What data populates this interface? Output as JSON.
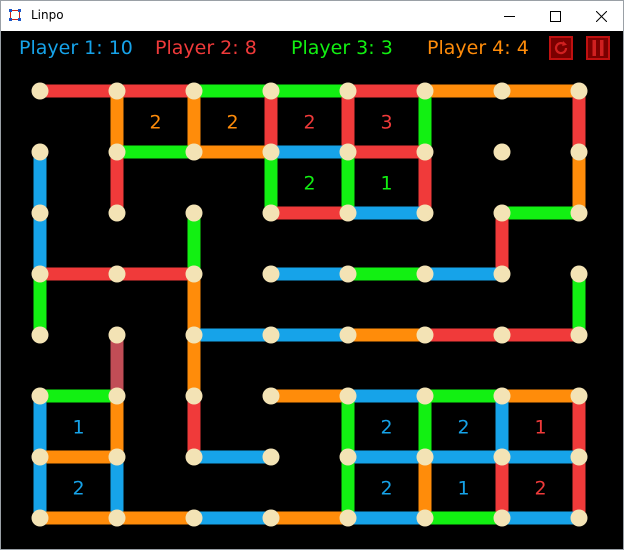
{
  "window": {
    "title": "Linpo",
    "controls": {
      "minimize": "─",
      "maximize": "☐",
      "close": "✕"
    }
  },
  "players": [
    {
      "label": "Player 1: 10",
      "color": "#16a3e9"
    },
    {
      "label": "Player 2: 8",
      "color": "#f03a3a"
    },
    {
      "label": "Player 3: 3",
      "color": "#12f012"
    },
    {
      "label": "Player 4: 4",
      "color": "#ff8c0a"
    }
  ],
  "toolbar": {
    "reset_icon": "restart-icon",
    "pause_icon": "pause-icon"
  },
  "board": {
    "dot_color": "#f3e3b5",
    "grid_cols": 8,
    "grid_rows": 8,
    "pending_color": "#c14d56",
    "edges": [
      [
        0,
        0,
        1,
        0,
        2
      ],
      [
        1,
        0,
        2,
        0,
        2
      ],
      [
        2,
        0,
        3,
        0,
        3
      ],
      [
        3,
        0,
        4,
        0,
        3
      ],
      [
        4,
        0,
        5,
        0,
        2
      ],
      [
        5,
        0,
        6,
        0,
        4
      ],
      [
        6,
        0,
        7,
        0,
        4
      ],
      [
        1,
        0,
        1,
        1,
        4
      ],
      [
        2,
        0,
        2,
        1,
        4
      ],
      [
        3,
        0,
        3,
        1,
        2
      ],
      [
        4,
        0,
        4,
        1,
        2
      ],
      [
        5,
        0,
        5,
        1,
        3
      ],
      [
        7,
        0,
        7,
        1,
        2
      ],
      [
        1,
        1,
        2,
        1,
        3
      ],
      [
        2,
        1,
        3,
        1,
        4
      ],
      [
        3,
        1,
        4,
        1,
        1
      ],
      [
        4,
        1,
        5,
        1,
        2
      ],
      [
        0,
        1,
        0,
        2,
        1
      ],
      [
        1,
        1,
        1,
        2,
        2
      ],
      [
        3,
        1,
        3,
        2,
        3
      ],
      [
        4,
        1,
        4,
        2,
        3
      ],
      [
        5,
        1,
        5,
        2,
        2
      ],
      [
        7,
        1,
        7,
        2,
        4
      ],
      [
        3,
        2,
        4,
        2,
        2
      ],
      [
        4,
        2,
        5,
        2,
        1
      ],
      [
        6,
        2,
        7,
        2,
        3
      ],
      [
        0,
        2,
        0,
        3,
        1
      ],
      [
        2,
        2,
        2,
        3,
        3
      ],
      [
        6,
        2,
        6,
        3,
        2
      ],
      [
        0,
        3,
        1,
        3,
        2
      ],
      [
        1,
        3,
        2,
        3,
        2
      ],
      [
        3,
        3,
        4,
        3,
        1
      ],
      [
        4,
        3,
        5,
        3,
        3
      ],
      [
        5,
        3,
        6,
        3,
        1
      ],
      [
        0,
        3,
        0,
        4,
        3
      ],
      [
        2,
        3,
        2,
        4,
        4
      ],
      [
        7,
        3,
        7,
        4,
        3
      ],
      [
        2,
        4,
        3,
        4,
        1
      ],
      [
        3,
        4,
        4,
        4,
        1
      ],
      [
        4,
        4,
        5,
        4,
        4
      ],
      [
        5,
        4,
        6,
        4,
        2
      ],
      [
        6,
        4,
        7,
        4,
        2
      ],
      [
        2,
        4,
        2,
        5,
        4
      ],
      [
        0,
        5,
        1,
        5,
        3
      ],
      [
        3,
        5,
        4,
        5,
        4
      ],
      [
        4,
        5,
        5,
        5,
        1
      ],
      [
        5,
        5,
        6,
        5,
        3
      ],
      [
        6,
        5,
        7,
        5,
        4
      ],
      [
        0,
        5,
        0,
        6,
        1
      ],
      [
        1,
        5,
        1,
        6,
        4
      ],
      [
        2,
        5,
        2,
        6,
        2
      ],
      [
        4,
        5,
        4,
        6,
        3
      ],
      [
        5,
        5,
        5,
        6,
        3
      ],
      [
        6,
        5,
        6,
        6,
        1
      ],
      [
        7,
        5,
        7,
        6,
        2
      ],
      [
        0,
        6,
        1,
        6,
        4
      ],
      [
        2,
        6,
        3,
        6,
        1
      ],
      [
        4,
        6,
        5,
        6,
        1
      ],
      [
        5,
        6,
        6,
        6,
        1
      ],
      [
        6,
        6,
        7,
        6,
        1
      ],
      [
        0,
        6,
        0,
        7,
        1
      ],
      [
        1,
        6,
        1,
        7,
        1
      ],
      [
        4,
        6,
        4,
        7,
        3
      ],
      [
        5,
        6,
        5,
        7,
        4
      ],
      [
        6,
        6,
        6,
        7,
        2
      ],
      [
        7,
        6,
        7,
        7,
        2
      ],
      [
        0,
        7,
        1,
        7,
        4
      ],
      [
        1,
        7,
        2,
        7,
        4
      ],
      [
        2,
        7,
        3,
        7,
        1
      ],
      [
        3,
        7,
        4,
        7,
        4
      ],
      [
        4,
        7,
        5,
        7,
        1
      ],
      [
        5,
        7,
        6,
        7,
        3
      ],
      [
        6,
        7,
        7,
        7,
        1
      ]
    ],
    "pending_edges": [
      [
        1,
        4,
        1,
        5
      ]
    ],
    "dots": [
      [
        0,
        0
      ],
      [
        1,
        0
      ],
      [
        2,
        0
      ],
      [
        3,
        0
      ],
      [
        4,
        0
      ],
      [
        5,
        0
      ],
      [
        6,
        0
      ],
      [
        7,
        0
      ],
      [
        0,
        1
      ],
      [
        1,
        1
      ],
      [
        2,
        1
      ],
      [
        3,
        1
      ],
      [
        4,
        1
      ],
      [
        5,
        1
      ],
      [
        6,
        1
      ],
      [
        7,
        1
      ],
      [
        0,
        2
      ],
      [
        1,
        2
      ],
      [
        2,
        2
      ],
      [
        3,
        2
      ],
      [
        4,
        2
      ],
      [
        5,
        2
      ],
      [
        6,
        2
      ],
      [
        7,
        2
      ],
      [
        0,
        3
      ],
      [
        1,
        3
      ],
      [
        2,
        3
      ],
      [
        3,
        3
      ],
      [
        4,
        3
      ],
      [
        5,
        3
      ],
      [
        6,
        3
      ],
      [
        7,
        3
      ],
      [
        0,
        4
      ],
      [
        1,
        4
      ],
      [
        2,
        4
      ],
      [
        3,
        4
      ],
      [
        4,
        4
      ],
      [
        5,
        4
      ],
      [
        6,
        4
      ],
      [
        7,
        4
      ],
      [
        0,
        5
      ],
      [
        1,
        5
      ],
      [
        2,
        5
      ],
      [
        3,
        5
      ],
      [
        4,
        5
      ],
      [
        5,
        5
      ],
      [
        6,
        5
      ],
      [
        7,
        5
      ],
      [
        0,
        6
      ],
      [
        1,
        6
      ],
      [
        2,
        6
      ],
      [
        3,
        6
      ],
      [
        4,
        6
      ],
      [
        5,
        6
      ],
      [
        6,
        6
      ],
      [
        7,
        6
      ],
      [
        0,
        7
      ],
      [
        1,
        7
      ],
      [
        2,
        7
      ],
      [
        3,
        7
      ],
      [
        4,
        7
      ],
      [
        5,
        7
      ],
      [
        6,
        7
      ],
      [
        7,
        7
      ]
    ],
    "boxes": [
      [
        1,
        0,
        "2",
        4
      ],
      [
        2,
        0,
        "2",
        4
      ],
      [
        3,
        0,
        "2",
        2
      ],
      [
        4,
        0,
        "3",
        2
      ],
      [
        3,
        1,
        "2",
        3
      ],
      [
        4,
        1,
        "1",
        3
      ],
      [
        0,
        5,
        "1",
        1
      ],
      [
        0,
        6,
        "2",
        1
      ],
      [
        4,
        5,
        "2",
        1
      ],
      [
        5,
        5,
        "2",
        1
      ],
      [
        6,
        5,
        "1",
        2
      ],
      [
        4,
        6,
        "2",
        1
      ],
      [
        5,
        6,
        "1",
        1
      ],
      [
        6,
        6,
        "2",
        2
      ]
    ]
  }
}
